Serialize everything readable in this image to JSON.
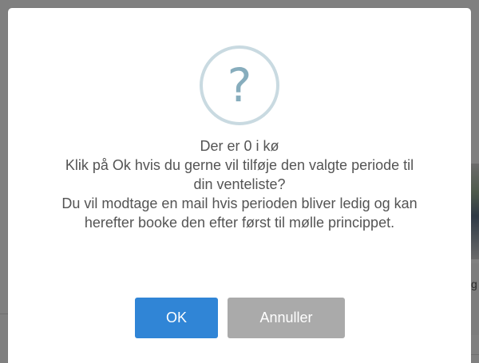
{
  "dialog": {
    "icon": "question-icon",
    "icon_glyph": "?",
    "message_lines": [
      "Der er 0 i kø",
      "Klik på Ok hvis du gerne vil tilføje den valgte periode til",
      "din venteliste?",
      "Du vil modtage en mail hvis perioden bliver ledig og kan",
      "herefter booke den efter først til mølle princippet."
    ],
    "confirm_label": "OK",
    "cancel_label": "Annuller"
  },
  "colors": {
    "overlay": "#7f7f7f",
    "confirm_button": "#3085d6",
    "cancel_button": "#aaaaaa",
    "icon_border": "#c9dae1",
    "icon_glyph": "#87adbd",
    "text": "#545454"
  }
}
